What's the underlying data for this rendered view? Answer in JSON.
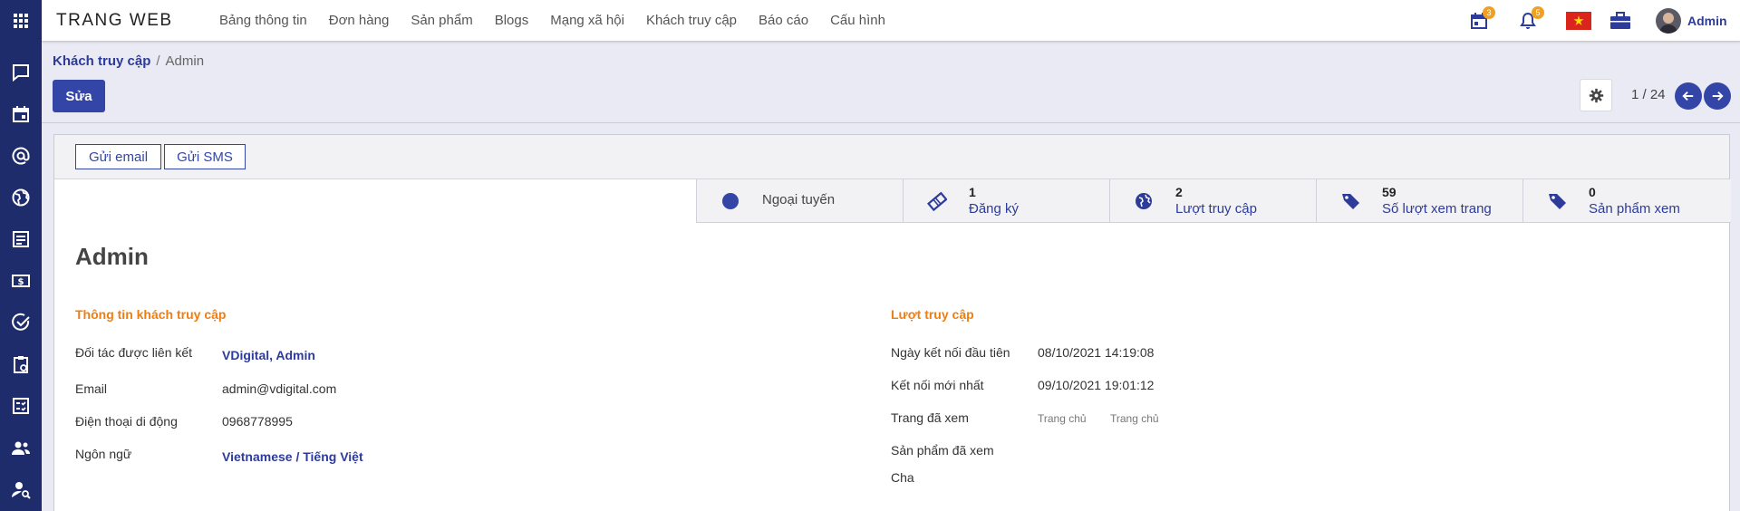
{
  "topbar": {
    "brand": "TRANG WEB",
    "menu": [
      "Bảng thông tin",
      "Đơn hàng",
      "Sản phẩm",
      "Blogs",
      "Mạng xã hội",
      "Khách truy cập",
      "Báo cáo",
      "Cấu hình"
    ],
    "activity_count": "3",
    "notification_count": "5",
    "user_name": "Admin"
  },
  "breadcrumb": {
    "parent": "Khách truy cập",
    "separator": "/",
    "current": "Admin"
  },
  "actions": {
    "edit_label": "Sửa"
  },
  "pager": {
    "text": "1 / 24"
  },
  "statusbar": {
    "send_email": "Gửi email",
    "send_sms": "Gửi SMS"
  },
  "smart_buttons": {
    "status": "Ngoại tuyến",
    "signups": {
      "count": "1",
      "label": "Đăng ký"
    },
    "visits": {
      "count": "2",
      "label": "Lượt truy cập"
    },
    "page_views": {
      "count": "59",
      "label": "Số lượt xem trang"
    },
    "product_views": {
      "count": "0",
      "label": "Sản phẩm xem"
    }
  },
  "record": {
    "name": "Admin",
    "section_visitor": "Thông tin khách truy cập",
    "section_visits": "Lượt truy cập",
    "fields": {
      "partner_label": "Đối tác được liên kết",
      "partner_value": "VDigital, Admin",
      "email_label": "Email",
      "email_value": "admin@vdigital.com",
      "mobile_label": "Điện thoại di động",
      "mobile_value": "0968778995",
      "lang_label": "Ngôn ngữ",
      "lang_value": "Vietnamese / Tiếng Việt",
      "first_conn_label": "Ngày kết nối đầu tiên",
      "first_conn_value": "08/10/2021 14:19:08",
      "last_conn_label": "Kết nối mới nhất",
      "last_conn_value": "09/10/2021 19:01:12",
      "pages_label": "Trang đã xem",
      "pages_values": [
        "Trang chủ",
        "Trang chủ"
      ],
      "products_label": "Sản phẩm đã xem",
      "parent_label": "Cha"
    }
  },
  "colors": {
    "rail": "#1f2c6b",
    "primary": "#3346a8",
    "accent": "#f07d10",
    "link": "#2d3b9a"
  },
  "icons": {
    "rail": [
      "apps-grid-icon",
      "chat-icon",
      "calendar-icon",
      "at-icon",
      "globe-icon",
      "newspaper-icon",
      "money-icon",
      "check-circle-icon",
      "clipboard-icon",
      "task-list-icon",
      "users-icon",
      "user-search-icon"
    ],
    "topbar": [
      "activity-calendar-icon",
      "bell-icon",
      "vietnam-flag-icon",
      "briefcase-icon"
    ]
  }
}
